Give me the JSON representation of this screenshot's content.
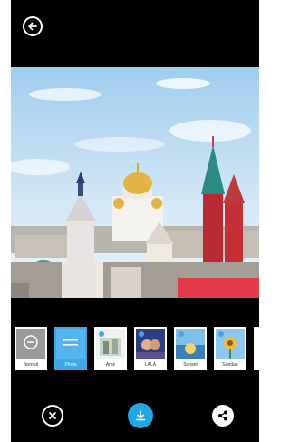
{
  "filters": [
    {
      "label": "Normal",
      "style": "normal"
    },
    {
      "label": "Photo",
      "style": "photo"
    },
    {
      "label": "Amé",
      "style": "ame"
    },
    {
      "label": "LALA",
      "style": "lala"
    },
    {
      "label": "Sunset",
      "style": "sunset"
    },
    {
      "label": "Sundae",
      "style": "sundae"
    }
  ],
  "selected_filter": "Photo",
  "colors": {
    "accent": "#22a7e6",
    "background": "#000000"
  },
  "icons": {
    "back": "back-arrow-icon",
    "close": "close-x-icon",
    "download": "download-icon",
    "share": "share-icon"
  }
}
